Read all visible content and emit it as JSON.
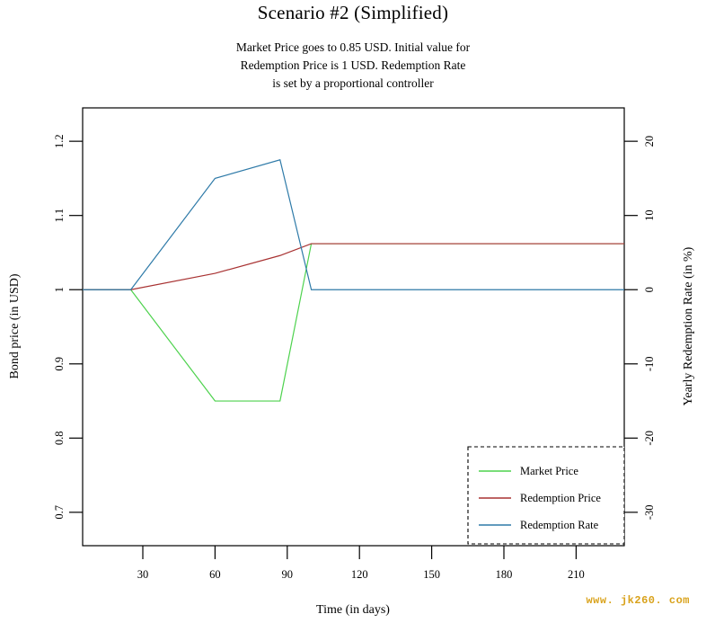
{
  "watermark": "www. jk260. com",
  "chart_data": {
    "type": "line",
    "title": "Scenario #2 (Simplified)",
    "subtitle_lines": [
      "Market Price goes to 0.85 USD. Initial value for",
      "Redemption Price is 1 USD. Redemption Rate",
      "is set by a proportional controller"
    ],
    "xlabel": "Time (in days)",
    "ylabel": "Bond price (in USD)",
    "y2label": "Yearly Redemption Rate (in %)",
    "xlim": [
      5,
      230
    ],
    "ylim": [
      0.655,
      1.245
    ],
    "y2lim": [
      -34.5,
      24.5
    ],
    "xticks": [
      30,
      60,
      90,
      120,
      150,
      180,
      210
    ],
    "yticks": [
      0.7,
      0.8,
      0.9,
      1,
      1.1,
      1.2
    ],
    "y2ticks": [
      -30,
      -20,
      -10,
      0,
      10,
      20
    ],
    "grid": false,
    "legend_position": "bottom-right",
    "series": [
      {
        "name": "Market Price",
        "axis": "left",
        "color": "#4dd24d",
        "x": [
          5,
          25,
          60,
          87,
          100,
          230
        ],
        "values": [
          1.0,
          1.0,
          0.85,
          0.85,
          1.062,
          1.062
        ]
      },
      {
        "name": "Redemption Price",
        "axis": "left",
        "color": "#a83232",
        "x": [
          5,
          25,
          60,
          87,
          100,
          230
        ],
        "values": [
          1.0,
          1.0,
          1.022,
          1.046,
          1.062,
          1.062
        ]
      },
      {
        "name": "Redemption Rate",
        "axis": "right",
        "color": "#2e7aa8",
        "x": [
          5,
          25,
          60,
          87,
          100,
          230
        ],
        "values": [
          0.0,
          0.0,
          15.0,
          17.5,
          0.0,
          0.0
        ]
      }
    ]
  },
  "legend": {
    "entries": [
      {
        "label": "Market Price",
        "color": "#4dd24d"
      },
      {
        "label": "Redemption Price",
        "color": "#a83232"
      },
      {
        "label": "Redemption Rate",
        "color": "#2e7aa8"
      }
    ]
  },
  "axes": {
    "x_tick_labels": [
      "30",
      "60",
      "90",
      "120",
      "150",
      "180",
      "210"
    ],
    "y_tick_labels": [
      "0.7",
      "0.8",
      "0.9",
      "1",
      "1.1",
      "1.2"
    ],
    "y2_tick_labels": [
      "-30",
      "-20",
      "-10",
      "0",
      "10",
      "20"
    ]
  }
}
